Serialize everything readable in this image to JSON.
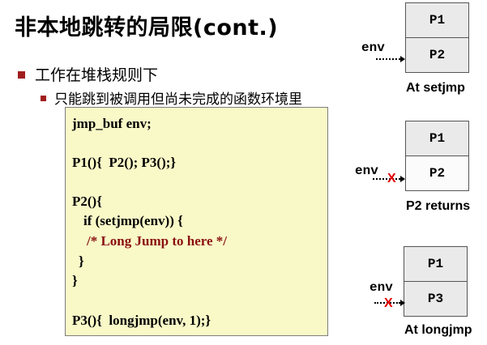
{
  "slide": {
    "title": "非本地跳转的局限(cont.)",
    "bullet1": "工作在堆栈规则下",
    "bullet2": "只能跳到被调用但尚未完成的函数环境里"
  },
  "code": {
    "line1": "jmp_buf env;",
    "line2": "P1(){  P2(); P3();}",
    "line3": "P2(){",
    "line4": "if (setjmp(env)) {",
    "line5": "/* Long Jump to here */",
    "line6": "}",
    "line7": "}",
    "line8": "P3(){  longjmp(env, 1);}"
  },
  "diagrams": {
    "d1": {
      "top": "P1",
      "bottom": "P2",
      "env": "env",
      "caption": "At setjmp"
    },
    "d2": {
      "top": "P1",
      "bottom": "P2",
      "env": "env",
      "x": "X",
      "caption": "P2 returns"
    },
    "d3": {
      "top": "P1",
      "bottom": "P3",
      "env": "env",
      "x": "X",
      "caption": "At longjmp"
    }
  },
  "colors": {
    "bullet": "#a11d1d",
    "code_bg": "#f9f9c8",
    "comment": "#8b1010",
    "cross": "#e00000",
    "stack_fill": "#eaeaea"
  }
}
